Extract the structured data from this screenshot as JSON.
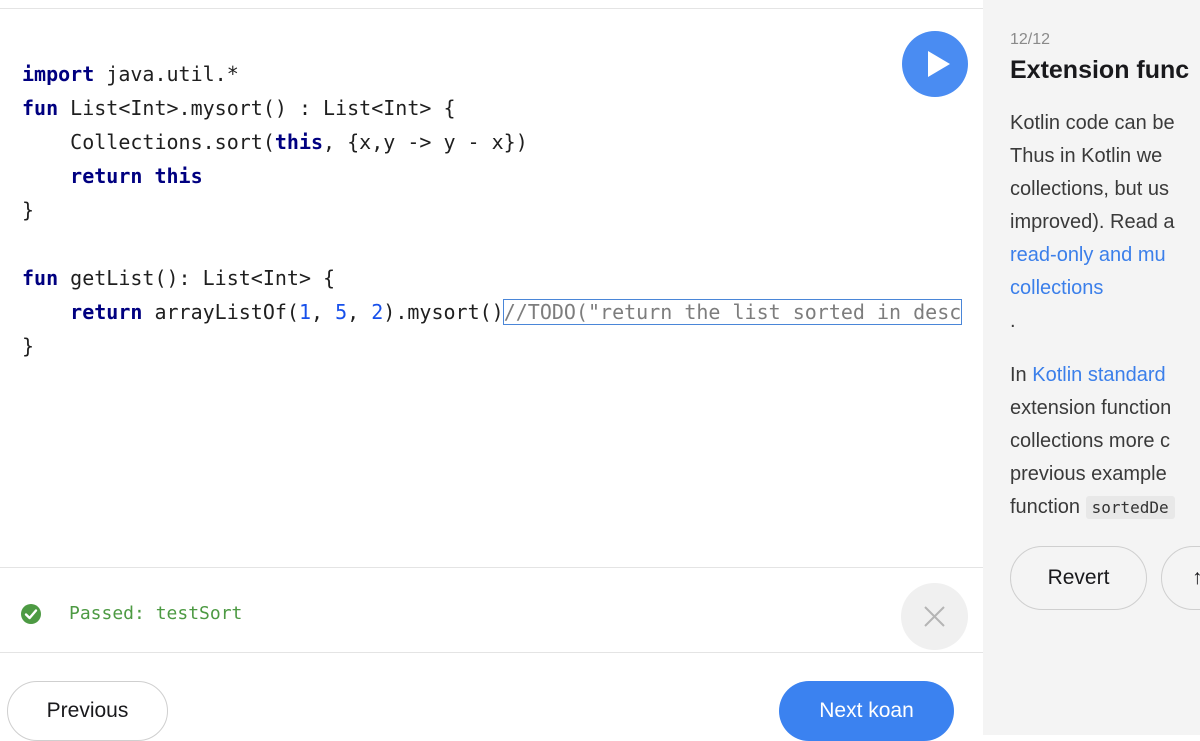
{
  "editor": {
    "lines": [
      [
        {
          "t": "import",
          "c": "kw"
        },
        {
          "t": " java.util.*"
        }
      ],
      [
        {
          "t": "fun",
          "c": "kw"
        },
        {
          "t": " List<Int>.mysort() : List<Int> {"
        }
      ],
      [
        {
          "t": "    Collections.sort("
        },
        {
          "t": "this",
          "c": "kw"
        },
        {
          "t": ", {x,y -> y - x})"
        }
      ],
      [
        {
          "t": "    "
        },
        {
          "t": "return",
          "c": "kw"
        },
        {
          "t": " "
        },
        {
          "t": "this",
          "c": "kw"
        }
      ],
      [
        {
          "t": "}"
        }
      ],
      [
        {
          "t": ""
        }
      ],
      [
        {
          "t": "fun",
          "c": "kw"
        },
        {
          "t": " getList(): List<Int> {"
        }
      ],
      [
        {
          "t": "    "
        },
        {
          "t": "return",
          "c": "kw"
        },
        {
          "t": " arrayListOf("
        },
        {
          "t": "1",
          "c": "num"
        },
        {
          "t": ", "
        },
        {
          "t": "5",
          "c": "num"
        },
        {
          "t": ", "
        },
        {
          "t": "2",
          "c": "num"
        },
        {
          "t": ").mysort()"
        },
        {
          "t": "//TODO(\"return the list sorted in desc",
          "c": "todo"
        }
      ],
      [
        {
          "t": "}"
        }
      ]
    ],
    "run_icon": "play-icon"
  },
  "console": {
    "status_icon": "check-circle-icon",
    "result": "Passed: testSort",
    "close_icon": "close-icon"
  },
  "nav": {
    "previous_label": "Previous",
    "next_label": "Next koan"
  },
  "panel": {
    "progress": "12/12",
    "title": "Extension func",
    "desc": {
      "l1": "Kotlin code can be",
      "l2": "Thus in Kotlin we",
      "l3": "collections, but us",
      "l4": "improved). Read a",
      "link1a": "read-only and mu",
      "link1b": "collections",
      "dot": ".",
      "l5_prefix": "In ",
      "link2": "Kotlin standard",
      "l6": "extension function",
      "l7": "collections more c",
      "l8": "previous example",
      "l9_prefix": "function ",
      "code": "sortedDe"
    },
    "revert_label": "Revert",
    "extra_label": "↑"
  },
  "colors": {
    "accent": "#3b82f0",
    "passed": "#4d9a43",
    "keyword": "#000080",
    "number": "#1750eb"
  }
}
